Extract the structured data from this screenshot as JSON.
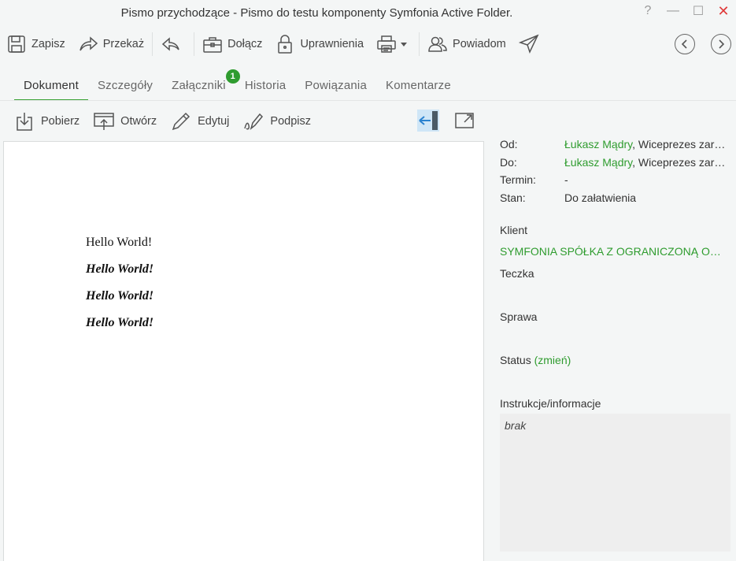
{
  "window": {
    "title": "Pismo przychodzące - Pismo do testu komponenty Symfonia Active Folder.",
    "help": "?",
    "minimize": "—",
    "maximize": "☐",
    "close": "✕"
  },
  "toolbar": {
    "save": "Zapisz",
    "forward": "Przekaż",
    "attach": "Dołącz",
    "permissions": "Uprawnienia",
    "notify": "Powiadom"
  },
  "tabs": [
    {
      "label": "Dokument"
    },
    {
      "label": "Szczegóły"
    },
    {
      "label": "Załączniki",
      "badge": "1"
    },
    {
      "label": "Historia"
    },
    {
      "label": "Powiązania"
    },
    {
      "label": "Komentarze"
    }
  ],
  "doc_toolbar": {
    "download": "Pobierz",
    "open": "Otwórz",
    "edit": "Edytuj",
    "sign": "Podpisz"
  },
  "document": {
    "lines": [
      "Hello World!",
      "Hello World!",
      "Hello World!",
      "Hello World!"
    ]
  },
  "details": {
    "from_label": "Od:",
    "from_name": "Łukasz Mądry",
    "from_rest": ", Wiceprezes zarządu",
    "to_label": "Do:",
    "to_name": "Łukasz Mądry",
    "to_rest": ", Wiceprezes zarządu",
    "deadline_label": "Termin:",
    "deadline_value": "-",
    "state_label": "Stan:",
    "state_value": "Do załatwienia",
    "client_label": "Klient",
    "client_value": "SYMFONIA SPÓŁKA Z OGRANICZONĄ ODPOWIEDZIALNOŚCIĄ",
    "folder_label": "Teczka",
    "case_label": "Sprawa",
    "status_label": "Status",
    "status_change": "(zmień)",
    "info_label": "Instrukcje/informacje",
    "info_value": "brak"
  },
  "colors": {
    "accent": "#3aa335",
    "link": "#2f9c2f",
    "close": "#e03a3a",
    "selected": "#cfe6f7"
  }
}
